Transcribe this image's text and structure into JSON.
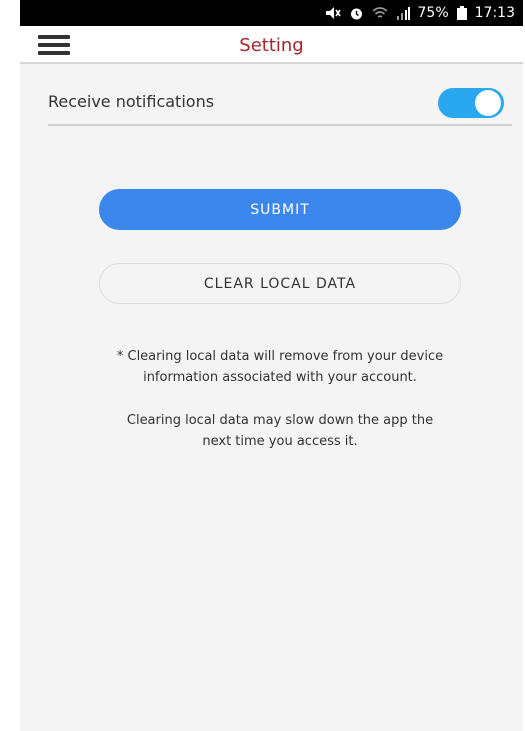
{
  "status_bar": {
    "battery": "75%",
    "time": "17:13",
    "icons": [
      "mute-icon",
      "alarm-icon",
      "wifi-icon",
      "signal-icon",
      "battery-icon"
    ]
  },
  "app_bar": {
    "title": "Setting",
    "menu_icon": "hamburger-menu-icon",
    "title_color": "#a52428"
  },
  "settings": {
    "notifications_label": "Receive notifications",
    "notifications_enabled": true,
    "toggle_color": "#29a8ef"
  },
  "actions": {
    "submit_label": "SUBMIT",
    "submit_color": "#3b87ee",
    "clear_label": "CLEAR LOCAL DATA"
  },
  "notes": {
    "clear_warning_line1": "* Clearing local data will remove from your device",
    "clear_warning_line2": "information associated with your account.",
    "slow_warning_line1": "Clearing local data may slow down the app the",
    "slow_warning_line2": "next time you access it."
  }
}
